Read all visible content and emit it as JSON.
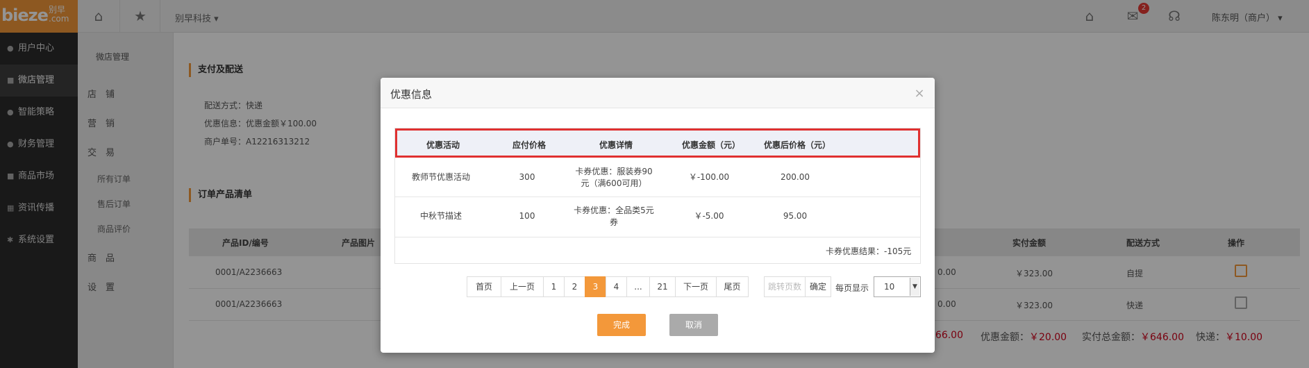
{
  "topbar": {
    "logo_main": "bieze",
    "logo_sub": "别早\n.com",
    "company": "别早科技",
    "company_caret": "▾",
    "mail_badge": "2",
    "user": "陈东明（商户）",
    "user_caret": "▾",
    "icons": [
      "home-icon",
      "star-icon",
      "home-icon",
      "mail-icon",
      "headset-icon"
    ]
  },
  "leftnav": {
    "items": [
      {
        "icon": "user-icon",
        "label": "用户中心",
        "active": false
      },
      {
        "icon": "shop-icon",
        "label": "微店管理",
        "active": true
      },
      {
        "icon": "bulb-icon",
        "label": "智能策略",
        "active": false
      },
      {
        "icon": "money-icon",
        "label": "财务管理",
        "active": false
      },
      {
        "icon": "market-icon",
        "label": "商品市场",
        "active": false
      },
      {
        "icon": "grid-icon",
        "label": "资讯传播",
        "active": false
      },
      {
        "icon": "gear-icon",
        "label": "系统设置",
        "active": false
      }
    ]
  },
  "subnav": {
    "title": "微店管理",
    "items": [
      {
        "label": "店　铺"
      },
      {
        "label": "营　销"
      },
      {
        "label": "交　易"
      },
      {
        "label": "所有订单"
      },
      {
        "label": "售后订单"
      },
      {
        "label": "商品评价"
      },
      {
        "label": "商　品"
      },
      {
        "label": "设　置"
      }
    ]
  },
  "main": {
    "section1": "支付及配送",
    "delivery": "配送方式：快递",
    "discount": "优惠信息：优惠金额￥100.00",
    "merchant_no": "商户单号：A12216313212",
    "section2": "订单产品清单",
    "table_headers": {
      "product_id": "产品ID/编号",
      "image": "产品图片",
      "paid": "实付金额",
      "shipping": "配送方式",
      "action": "操作"
    },
    "rows": [
      {
        "id": "0001/A2236663",
        "amount_tail": "0.00",
        "paid": "￥323.00",
        "shipping": "自提"
      },
      {
        "id": "0001/A2236663",
        "amount_tail": "0.00",
        "paid": "￥323.00",
        "shipping": "快递"
      }
    ],
    "footer": {
      "total_tail": "666.00",
      "discount_label": "优惠金额：",
      "discount_value": "￥20.00",
      "paid_label": "实付总金额：",
      "paid_value": "￥646.00",
      "express_label": "快递：",
      "express_value": "￥10.00"
    }
  },
  "modal": {
    "title": "优惠信息",
    "close": "×",
    "headers": [
      "优惠活动",
      "应付价格",
      "优惠详情",
      "优惠金额（元）",
      "优惠后价格（元）"
    ],
    "rows": [
      {
        "activity": "教师节优惠活动",
        "price": "300",
        "detail1": "卡券优惠：服装券90",
        "detail2": "元（满600可用）",
        "amount": "￥-100.00",
        "after": "200.00"
      },
      {
        "activity": "中秋节描述",
        "price": "100",
        "detail1": "卡券优惠：全品类5元",
        "detail2": "券",
        "amount": "￥-5.00",
        "after": "95.00"
      }
    ],
    "summary": "卡券优惠结果：-105元",
    "pager": {
      "first": "首页",
      "prev": "上一页",
      "pages": [
        "1",
        "2",
        "3",
        "4",
        "...",
        "21"
      ],
      "current": "3",
      "next": "下一页",
      "last": "尾页",
      "jump_placeholder": "跳转页数",
      "confirm": "确定",
      "per_page_label": "每页显示",
      "per_page_value": "10"
    },
    "ok_button": "完成",
    "cancel_button": "取消"
  },
  "colors": {
    "accent": "#f3983a",
    "highlight_border": "#e03030",
    "nav_bg": "#2b2b2b"
  }
}
